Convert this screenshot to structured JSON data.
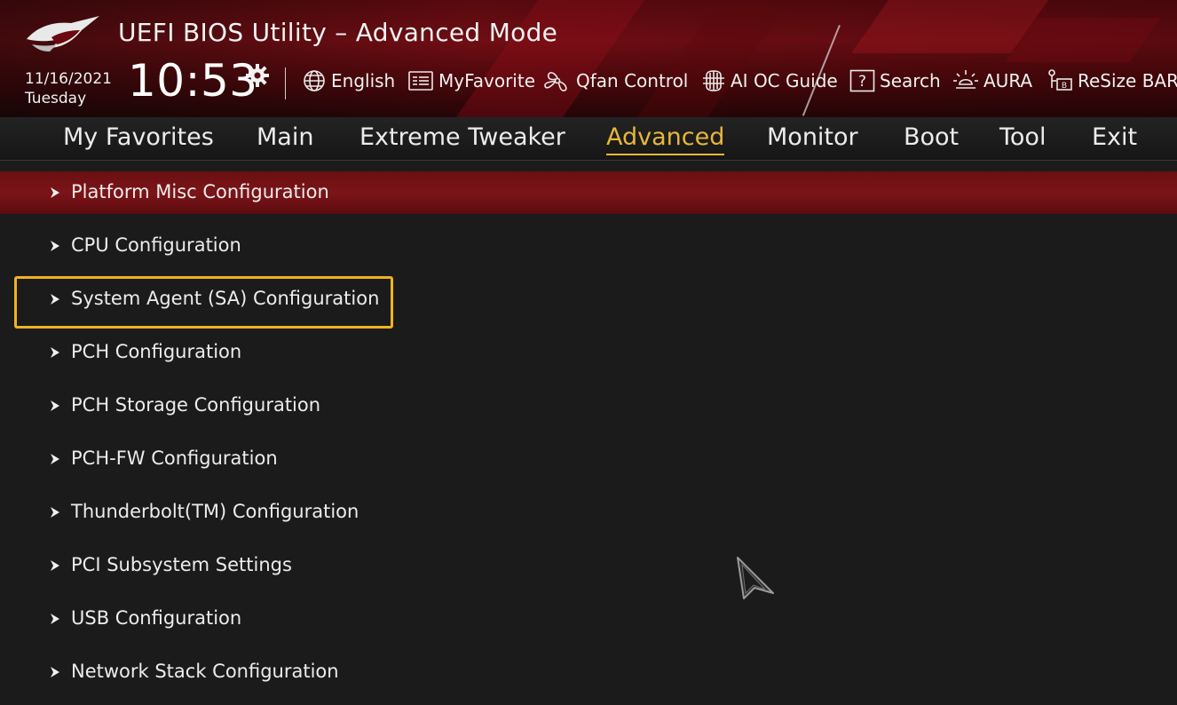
{
  "header": {
    "title": "UEFI BIOS Utility – Advanced Mode",
    "date": "11/16/2021",
    "weekday": "Tuesday",
    "time": "10:53",
    "tools": [
      {
        "label": "English",
        "icon": "globe-icon"
      },
      {
        "label": "MyFavorite",
        "icon": "favorite-list-icon"
      },
      {
        "label": "Qfan Control",
        "icon": "fan-icon"
      },
      {
        "label": "AI OC Guide",
        "icon": "ai-chip-icon"
      },
      {
        "label": "Search",
        "icon": "help-search-icon"
      },
      {
        "label": "AURA",
        "icon": "aura-light-icon"
      },
      {
        "label": "ReSize BAR",
        "icon": "resize-bar-icon"
      }
    ]
  },
  "tabs": [
    {
      "label": "My Favorites"
    },
    {
      "label": "Main"
    },
    {
      "label": "Extreme Tweaker"
    },
    {
      "label": "Advanced",
      "active": true
    },
    {
      "label": "Monitor"
    },
    {
      "label": "Boot"
    },
    {
      "label": "Tool"
    },
    {
      "label": "Exit"
    }
  ],
  "menu": {
    "items": [
      {
        "label": "Platform Misc Configuration",
        "selected": true
      },
      {
        "label": "CPU Configuration"
      },
      {
        "label": "System Agent (SA) Configuration",
        "highlighted": true
      },
      {
        "label": "PCH Configuration"
      },
      {
        "label": "PCH Storage Configuration"
      },
      {
        "label": "PCH-FW Configuration"
      },
      {
        "label": "Thunderbolt(TM) Configuration"
      },
      {
        "label": "PCI Subsystem Settings"
      },
      {
        "label": "USB Configuration"
      },
      {
        "label": "Network Stack Configuration"
      }
    ]
  },
  "colors": {
    "accent": "#e6b73a",
    "highlight_box": "#f0b21e",
    "selected_row": "#7b1418"
  }
}
